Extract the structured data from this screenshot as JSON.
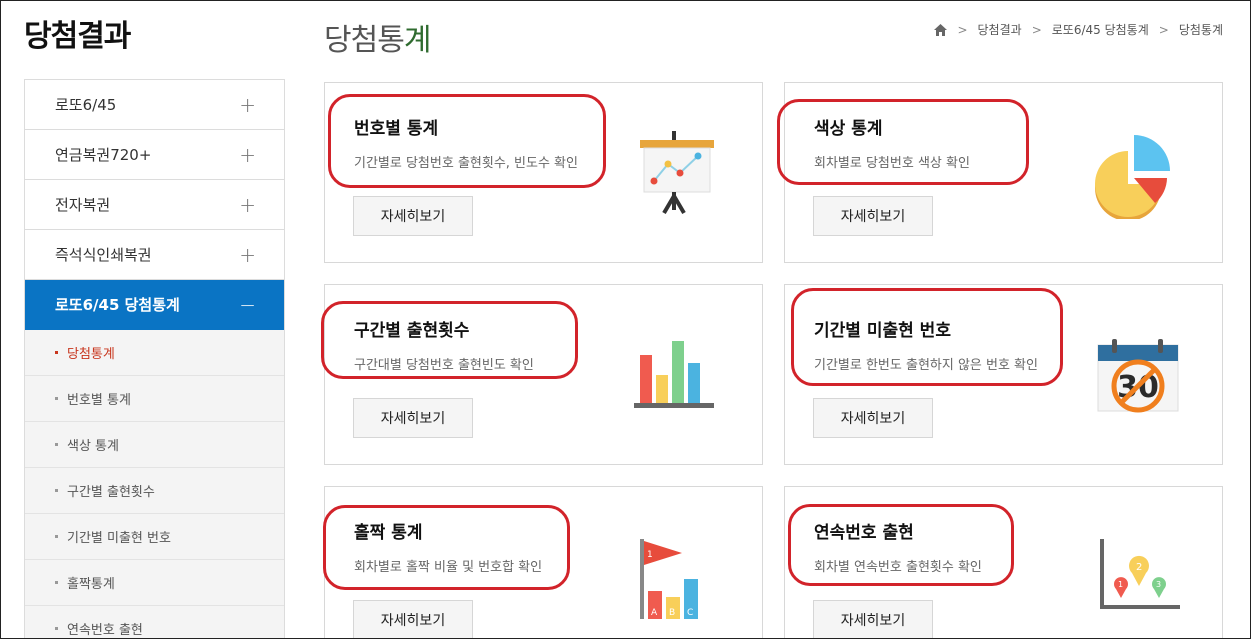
{
  "section_title": "당첨결과",
  "page_title": {
    "main": "당첨통",
    "accent": "계"
  },
  "breadcrumb": [
    "당첨결과",
    "로또6/45 당첨통계",
    "당첨통계"
  ],
  "sidebar": {
    "items": [
      {
        "label": "로또6/45",
        "toggle": "+"
      },
      {
        "label": "연금복권720+",
        "toggle": "+"
      },
      {
        "label": "전자복권",
        "toggle": "+"
      },
      {
        "label": "즉석식인쇄복권",
        "toggle": "+"
      },
      {
        "label": "로또6/45 당첨통계",
        "toggle": "−"
      }
    ],
    "subitems": [
      "당첨통계",
      "번호별 통계",
      "색상 통계",
      "구간별 출현횟수",
      "기간별 미출현 번호",
      "홀짝통계",
      "연속번호 출현"
    ]
  },
  "cards": [
    {
      "title": "번호별 통계",
      "desc": "기간별로 당첨번호 출현횟수, 빈도수 확인",
      "button": "자세히보기",
      "icon": "presentation-chart-icon"
    },
    {
      "title": "색상 통계",
      "desc": "회차별로 당첨번호 색상 확인",
      "button": "자세히보기",
      "icon": "pie-chart-icon"
    },
    {
      "title": "구간별 출현횟수",
      "desc": "구간대별 당첨번호 출현빈도 확인",
      "button": "자세히보기",
      "icon": "bar-chart-icon"
    },
    {
      "title": "기간별 미출현 번호",
      "desc": "기간별로 한번도 출현하지 않은 번호 확인",
      "button": "자세히보기",
      "icon": "calendar-30-icon"
    },
    {
      "title": "홀짝 통계",
      "desc": "회차별로 홀짝 비율 및 번호합 확인",
      "button": "자세히보기",
      "icon": "flag-bar-icon"
    },
    {
      "title": "연속번호 출현",
      "desc": "회차별 연속번호 출현횟수 확인",
      "button": "자세히보기",
      "icon": "map-pins-chart-icon"
    }
  ],
  "calendar_number": "30",
  "colors": {
    "active": "#0a74c4",
    "highlight": "#d2232a",
    "current_sub": "#c8361e"
  }
}
